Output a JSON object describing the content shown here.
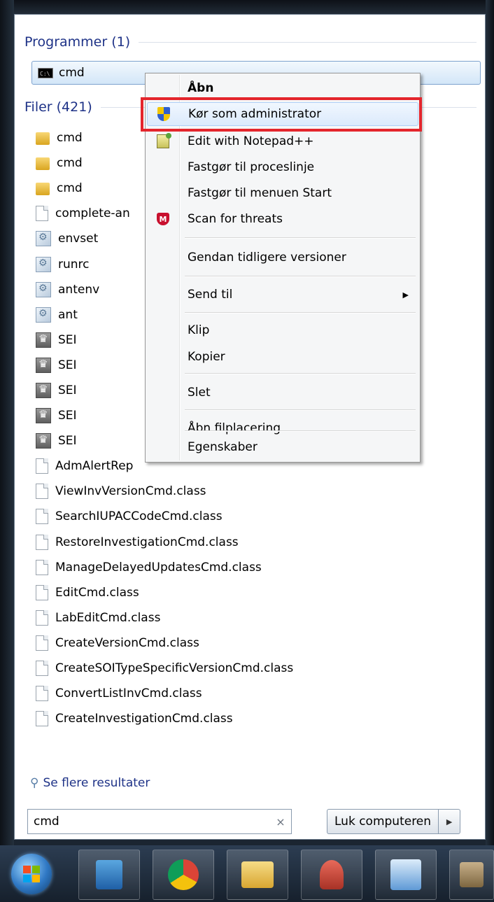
{
  "programs": {
    "header": "Programmer (1)",
    "items": [
      {
        "label": "cmd",
        "icon": "cmd-console-icon"
      }
    ]
  },
  "files": {
    "header": "Filer (421)",
    "items": [
      {
        "label": "cmd",
        "icon": "folder-icon"
      },
      {
        "label": "cmd",
        "icon": "folder-icon"
      },
      {
        "label": "cmd",
        "icon": "folder-icon"
      },
      {
        "label": "complete-an",
        "icon": "document-icon"
      },
      {
        "label": "envset",
        "icon": "config-file-icon"
      },
      {
        "label": "runrc",
        "icon": "config-file-icon"
      },
      {
        "label": "antenv",
        "icon": "config-file-icon"
      },
      {
        "label": "ant",
        "icon": "config-file-icon"
      },
      {
        "label": "SEI",
        "icon": "crown-file-icon"
      },
      {
        "label": "SEI",
        "icon": "crown-file-icon"
      },
      {
        "label": "SEI",
        "icon": "crown-file-icon"
      },
      {
        "label": "SEI",
        "icon": "crown-file-icon"
      },
      {
        "label": "SEI",
        "icon": "crown-file-icon"
      },
      {
        "label": "AdmAlertRep",
        "icon": "document-icon"
      },
      {
        "label": "ViewInvVersionCmd.class",
        "icon": "document-icon"
      },
      {
        "label": "SearchIUPACCodeCmd.class",
        "icon": "document-icon"
      },
      {
        "label": "RestoreInvestigationCmd.class",
        "icon": "document-icon"
      },
      {
        "label": "ManageDelayedUpdatesCmd.class",
        "icon": "document-icon"
      },
      {
        "label": "EditCmd.class",
        "icon": "document-icon"
      },
      {
        "label": "LabEditCmd.class",
        "icon": "document-icon"
      },
      {
        "label": "CreateVersionCmd.class",
        "icon": "document-icon"
      },
      {
        "label": "CreateSOITypeSpecificVersionCmd.class",
        "icon": "document-icon"
      },
      {
        "label": "ConvertListInvCmd.class",
        "icon": "document-icon"
      },
      {
        "label": "CreateInvestigationCmd.class",
        "icon": "document-icon"
      }
    ]
  },
  "context_menu": {
    "items": [
      {
        "label": "Åbn"
      },
      {
        "label": "Kør som administrator"
      },
      {
        "label": "Edit with Notepad++"
      },
      {
        "label": "Fastgør til proceslinje"
      },
      {
        "label": "Fastgør til menuen Start"
      },
      {
        "label": "Scan for threats"
      },
      {
        "label": "Gendan tidligere versioner"
      },
      {
        "label": "Send til"
      },
      {
        "label": "Klip"
      },
      {
        "label": "Kopier"
      },
      {
        "label": "Slet"
      },
      {
        "label": "Åbn filplacering"
      },
      {
        "label": "Egenskaber"
      }
    ],
    "highlight_color": "#e4252c",
    "mcafee_letter": "M"
  },
  "see_more": {
    "label": "Se flere resultater"
  },
  "search": {
    "value": "cmd",
    "clear_glyph": "×"
  },
  "shutdown": {
    "label": "Luk computeren"
  }
}
